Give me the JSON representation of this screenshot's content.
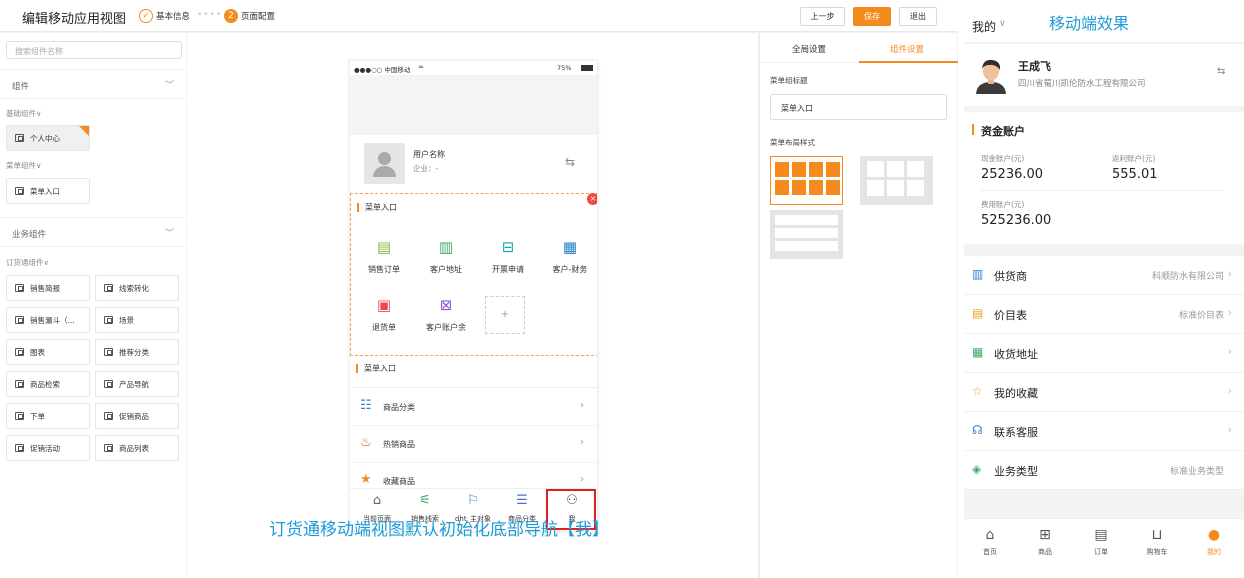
{
  "editor": {
    "title": "编辑移动应用视图",
    "steps": [
      {
        "num": "✓",
        "label": "基本信息"
      },
      {
        "num": "2",
        "label": "页面配置"
      }
    ],
    "buttons": {
      "prev": "上一步",
      "save": "保存",
      "exit": "退出"
    }
  },
  "left": {
    "search_placeholder": "搜索组件名称",
    "sections": [
      {
        "label": "组件"
      },
      {
        "label": "业务组件"
      }
    ],
    "groups": [
      "基础组件∨",
      "菜单组件∨",
      "订货通组件∨"
    ],
    "basic": [
      "个人中心"
    ],
    "menu": [
      "菜单入口"
    ],
    "biz": [
      "销售简报",
      "线索转化",
      "销售漏斗（...",
      "场景",
      "图表",
      "推荐分类",
      "商品检索",
      "产品导航",
      "下单",
      "促销商品",
      "促销活动",
      "商品列表"
    ]
  },
  "phone": {
    "status": {
      "carrier": "●●●○○ 中国移动",
      "battery": "75%"
    },
    "user": {
      "name": "用户名称",
      "company": "企业：-"
    },
    "menu1": {
      "title": "菜单入口",
      "items": [
        "销售订单",
        "客户地址",
        "开票申请",
        "客户-财务",
        "退货单",
        "客户账户余"
      ]
    },
    "menu2": {
      "title": "菜单入口",
      "rows": [
        "商品分类",
        "热销商品",
        "收藏商品"
      ]
    },
    "tabs": [
      "当前页面",
      "销售线索",
      "dht_主对象",
      "商品分类",
      "我"
    ],
    "caption": "订货通移动端视图默认初始化底部导航【我】"
  },
  "settings": {
    "tabs": [
      "全局设置",
      "组件设置"
    ],
    "title_label": "菜单组标题",
    "title_value": "菜单入口",
    "layout_label": "菜单布局样式"
  },
  "mobile": {
    "header": "我的",
    "effect_label": "移动端效果",
    "user": {
      "name": "王成飞",
      "company": "四川省蜀川凯伦防水工程有限公司"
    },
    "account_title": "资金账户",
    "accounts": [
      {
        "label": "现金账户(元)",
        "value": "25236.00"
      },
      {
        "label": "返利账户(元)",
        "value": "555.01"
      },
      {
        "label": "费用账户(元)",
        "value": "525236.00"
      }
    ],
    "rows": [
      {
        "label": "供货商",
        "value": "科顺防水有限公司"
      },
      {
        "label": "价目表",
        "value": "标准价目表"
      },
      {
        "label": "收货地址",
        "value": ""
      },
      {
        "label": "我的收藏",
        "value": ""
      },
      {
        "label": "联系客服",
        "value": ""
      },
      {
        "label": "业务类型",
        "value": "标准业务类型"
      }
    ],
    "tabs": [
      "首页",
      "商品",
      "订单",
      "购物车",
      "我的"
    ],
    "accent": "#f58a1f",
    "blue": "#1e9bd7"
  }
}
